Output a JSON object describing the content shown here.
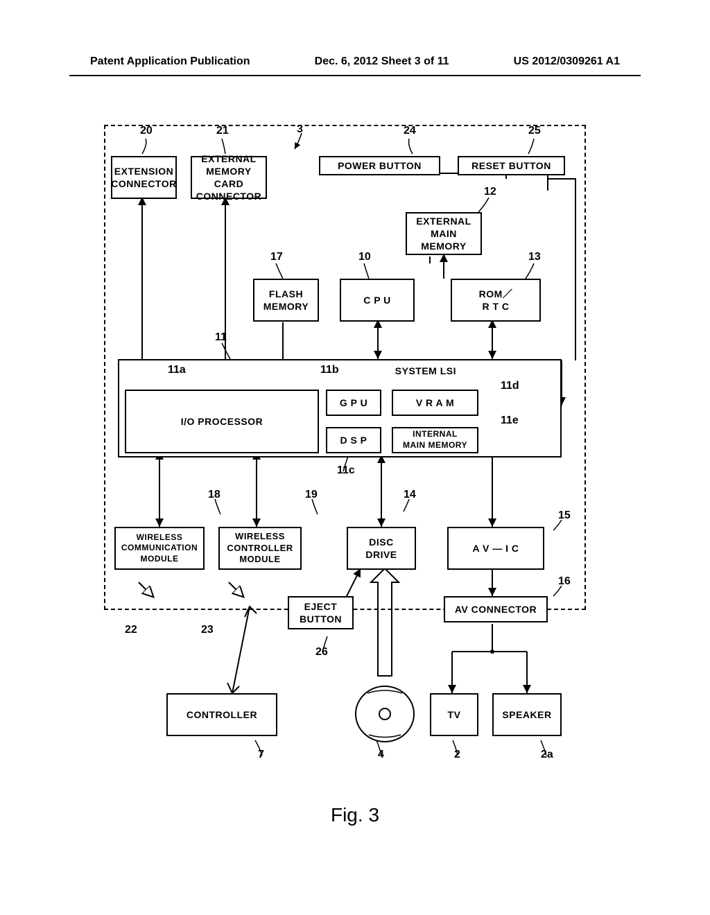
{
  "header": {
    "left": "Patent Application Publication",
    "center": "Dec. 6, 2012   Sheet 3 of 11",
    "right": "US 2012/0309261 A1"
  },
  "refs": {
    "r3": "3",
    "r20": "20",
    "r21": "21",
    "r24": "24",
    "r25": "25",
    "r12": "12",
    "r17": "17",
    "r10": "10",
    "r13": "13",
    "r11": "11",
    "r11a": "11a",
    "r11b": "11b",
    "r11c": "11c",
    "r11d": "11d",
    "r11e": "11e",
    "r18": "18",
    "r19": "19",
    "r14": "14",
    "r15": "15",
    "r16": "16",
    "r26": "26",
    "r22": "22",
    "r23": "23",
    "r7": "7",
    "r4": "4",
    "r2": "2",
    "r2a": "2a"
  },
  "boxes": {
    "extension_connector": "EXTENSION\nCONNECTOR",
    "ext_mem_card": "EXTERNAL\nMEMORY CARD\nCONNECTOR",
    "power_button": "POWER BUTTON",
    "reset_button": "RESET BUTTON",
    "ext_main_mem": "EXTERNAL\nMAIN\nMEMORY",
    "flash_mem": "FLASH\nMEMORY",
    "cpu": "C P U",
    "rom_rtc": "ROM／\nR T C",
    "system_lsi": "SYSTEM LSI",
    "io_processor": "I/O PROCESSOR",
    "gpu": "G P U",
    "vram": "V R A M",
    "dsp": "D S P",
    "int_main_mem": "INTERNAL\nMAIN MEMORY",
    "wireless_comm": "WIRELESS\nCOMMUNICATION\nMODULE",
    "wireless_ctrl": "WIRELESS\nCONTROLLER\nMODULE",
    "disc_drive": "DISC\nDRIVE",
    "av_ic": "A V — I C",
    "eject_button": "EJECT\nBUTTON",
    "av_connector": "AV CONNECTOR",
    "controller": "CONTROLLER",
    "tv": "TV",
    "speaker": "SPEAKER"
  },
  "fig_caption": "Fig. 3"
}
